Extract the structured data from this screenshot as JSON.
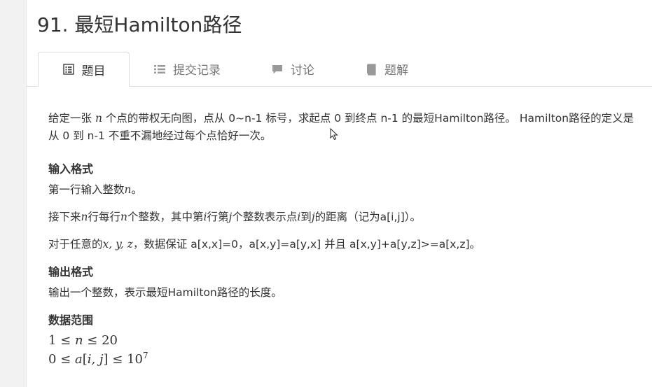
{
  "problem": {
    "title": "91. 最短Hamilton路径"
  },
  "tabs": [
    {
      "label": "题目",
      "icon": "list-alt-icon",
      "active": true
    },
    {
      "label": "提交记录",
      "icon": "list-icon",
      "active": false
    },
    {
      "label": "讨论",
      "icon": "comment-icon",
      "active": false
    },
    {
      "label": "题解",
      "icon": "book-icon",
      "active": false
    }
  ],
  "description": {
    "line1_a": "给定一张 ",
    "line1_var": "n",
    "line1_b": " 个点的带权无向图，点从 0~n-1 标号，求起点 0 到终点 n-1 的最短Hamilton路径。 Hamilton路径的定义是从 0 到 n-1 不重不漏地经过每个点恰好一次。"
  },
  "input_format": {
    "heading": "输入格式",
    "p1_a": "第一行输入整数",
    "p1_var": "n",
    "p1_b": "。",
    "p2_a": "接下来",
    "p2_v1": "n",
    "p2_b": "行每行",
    "p2_v2": "n",
    "p2_c": "个整数，其中第",
    "p2_v3": "i",
    "p2_d": "行第",
    "p2_v4": "j",
    "p2_e": "个整数表示点",
    "p2_v5": "i",
    "p2_f": "到",
    "p2_v6": "j",
    "p2_g": "的距离（记为a[i,j]）。",
    "p3_a": "对于任意的",
    "p3_var": "x, y, z",
    "p3_b": "，数据保证 a[x,x]=0，a[x,y]=a[y,x] 并且 a[x,y]+a[y,z]>=a[x,z]。"
  },
  "output_format": {
    "heading": "输出格式",
    "p1": "输出一个整数，表示最短Hamilton路径的长度。"
  },
  "data_range": {
    "heading": "数据范围",
    "r1_a": "1 ≤ ",
    "r1_var": "n",
    "r1_b": " ≤ 20",
    "r2_a": "0 ≤ ",
    "r2_var": "a",
    "r2_b": "[",
    "r2_var2": "i, j",
    "r2_c": "] ≤ 10",
    "r2_exp": "7"
  }
}
